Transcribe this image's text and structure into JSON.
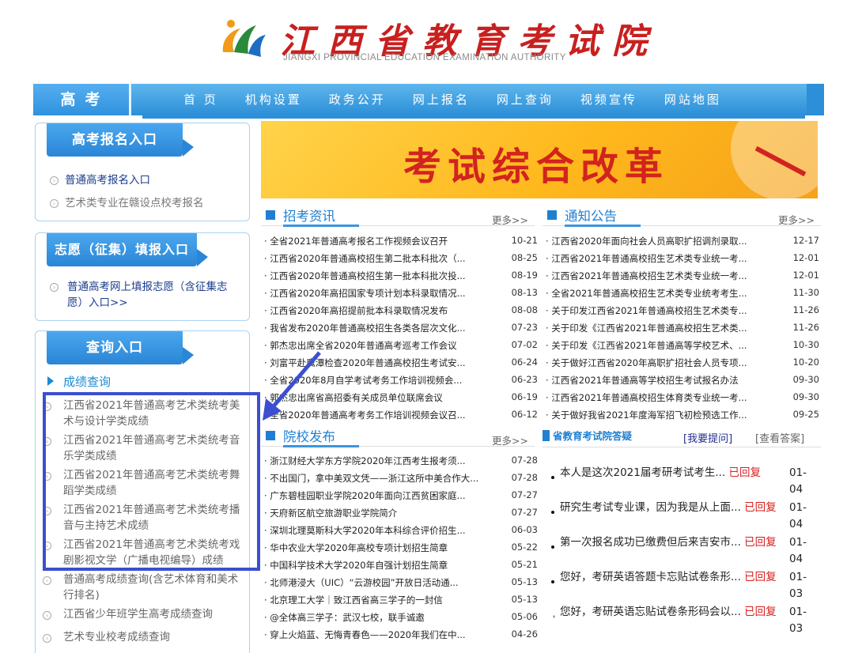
{
  "header": {
    "title_cn": "江西省教育考试院",
    "title_en": "JIANGXI PROVINCIAL EDUCATION EXAMINATION AUTHORITY"
  },
  "nav": {
    "home": "高考",
    "items": [
      "首 页",
      "机构设置",
      "政务公开",
      "网上报名",
      "网上查询",
      "视频宣传",
      "网站地图"
    ]
  },
  "sidebar": {
    "register": {
      "title": "高考报名入口",
      "links": [
        "普通高考报名入口",
        "艺术类专业在赣设点校考报名"
      ]
    },
    "volunteer": {
      "title": "志愿（征集）填报入口",
      "links": [
        "普通高考网上填报志愿（含征集志愿）入口>>"
      ]
    },
    "query": {
      "title": "查询入口",
      "section": "成绩查询",
      "links": [
        "江西省2021年普通高考艺术类统考美术与设计学类成绩",
        "江西省2021年普通高考艺术类统考音乐学类成绩",
        "江西省2021年普通高考艺术类统考舞蹈学类成绩",
        "江西省2021年普通高考艺术类统考播音与主持艺术成绩",
        "江西省2021年普通高考艺术类统考戏剧影视文学（广播电视编导）成绩",
        "普通高考成绩查询(含艺术体育和美术行排名)",
        "江西省少年班学生高考成绩查询",
        "艺术专业校考成绩查询"
      ]
    }
  },
  "banner": {
    "text": "考试综合改革"
  },
  "recruit": {
    "title": "招考资讯",
    "more": "更多>>",
    "items": [
      {
        "t": "· 全省2021年普通高考报名工作视频会议召开",
        "d": "10-21"
      },
      {
        "t": "· 江西省2020年普通高校招生第二批本科批次（...",
        "d": "08-25"
      },
      {
        "t": "· 江西省2020年普通高校招生第一批本科批次投...",
        "d": "08-19"
      },
      {
        "t": "· 江西省2020年高招国家专项计划本科录取情况...",
        "d": "08-13"
      },
      {
        "t": "· 江西省2020年高招提前批本科录取情况发布",
        "d": "08-08"
      },
      {
        "t": "· 我省发布2020年普通高校招生各类各层次文化...",
        "d": "07-23"
      },
      {
        "t": "· 郭杰忠出席全省2020年普通高考巡考工作会议",
        "d": "07-02"
      },
      {
        "t": "· 刘富平赴鹰潭检查2020年普通高校招生考试安...",
        "d": "06-24"
      },
      {
        "t": "· 全省2020年8月自学考试考务工作培训视频会...",
        "d": "06-23"
      },
      {
        "t": "· 郭杰忠出席省高招委有关成员单位联席会议",
        "d": "06-19"
      },
      {
        "t": "· 全省2020年普通高考考务工作培训视频会议召...",
        "d": "06-12"
      }
    ]
  },
  "notice": {
    "title": "通知公告",
    "more": "更多>>",
    "items": [
      {
        "t": "· 江西省2020年面向社会人员高职扩招调剂录取...",
        "d": "12-17"
      },
      {
        "t": "· 江西省2021年普通高校招生艺术类专业统一考...",
        "d": "12-01"
      },
      {
        "t": "· 江西省2021年普通高校招生艺术类专业统一考...",
        "d": "12-01"
      },
      {
        "t": "· 全省2021年普通高校招生艺术类专业统考考生...",
        "d": "11-30"
      },
      {
        "t": "· 关于印发江西省2021年普通高校招生艺术类专...",
        "d": "11-26"
      },
      {
        "t": "· 关于印发《江西省2021年普通高校招生艺术类...",
        "d": "11-26"
      },
      {
        "t": "· 关于印发《江西省2021年普通高等学校艺术、...",
        "d": "10-30"
      },
      {
        "t": "· 关于做好江西省2020年高职扩招社会人员专项...",
        "d": "10-20"
      },
      {
        "t": "· 江西省2021年普通高等学校招生考试报名办法",
        "d": "09-30"
      },
      {
        "t": "· 江西省2021年普通高校招生体育类专业统一考...",
        "d": "09-30"
      },
      {
        "t": "· 关于做好我省2021年度海军招飞初检预选工作...",
        "d": "09-25"
      }
    ]
  },
  "schools": {
    "title": "院校发布",
    "more": "更多>>",
    "items": [
      {
        "t": "· 浙江财经大学东方学院2020年江西考生报考须...",
        "d": "07-28"
      },
      {
        "t": "· 不出国门，拿中美双文凭——浙江这所中美合作大...",
        "d": "07-28"
      },
      {
        "t": "· 广东碧桂园职业学院2020年面向江西贫困家庭...",
        "d": "07-27"
      },
      {
        "t": "· 天府新区航空旅游职业学院简介",
        "d": "07-27"
      },
      {
        "t": "· 深圳北理莫斯科大学2020年本科综合评价招生...",
        "d": "06-03"
      },
      {
        "t": "· 华中农业大学2020年高校专项计划招生简章",
        "d": "05-22"
      },
      {
        "t": "· 中国科学技术大学2020年自强计划招生简章",
        "d": "05-21"
      },
      {
        "t": "· 北师港浸大（UIC）“云游校园”开放日活动通...",
        "d": "05-13"
      },
      {
        "t": "· 北京理工大学｜致江西省高三学子的一封信",
        "d": "05-13"
      },
      {
        "t": "· @全体高三学子：武汉七校，联手诚邀",
        "d": "05-06"
      },
      {
        "t": "· 穿上火焰蓝、无悔青春色——2020年我们在中...",
        "d": "04-26"
      }
    ]
  },
  "qa": {
    "title": "省教育考试院答疑",
    "ask": "[我要提问]",
    "view": "[查看答案]",
    "items": [
      {
        "q": "本人是这次2021届考研考试考生...",
        "status": "已回复",
        "date": "01-04"
      },
      {
        "q": "研究生考试专业课，因为我是从上面...",
        "status": "已回复",
        "date": "01-04"
      },
      {
        "q": "第一次报名成功已缴费但后来吉安市...",
        "status": "已回复",
        "date": "01-04"
      },
      {
        "q": "您好，考研英语答题卡忘贴试卷条形...",
        "status": "已回复",
        "date": "01-03"
      },
      {
        "q": "您好，考研英语忘贴试卷条形码会以...",
        "status": "已回复",
        "date": "01-03"
      }
    ]
  },
  "colors": {
    "brand_blue": "#2c8fd8",
    "title_red": "#c8201f",
    "annotation": "#3b4fcf"
  }
}
